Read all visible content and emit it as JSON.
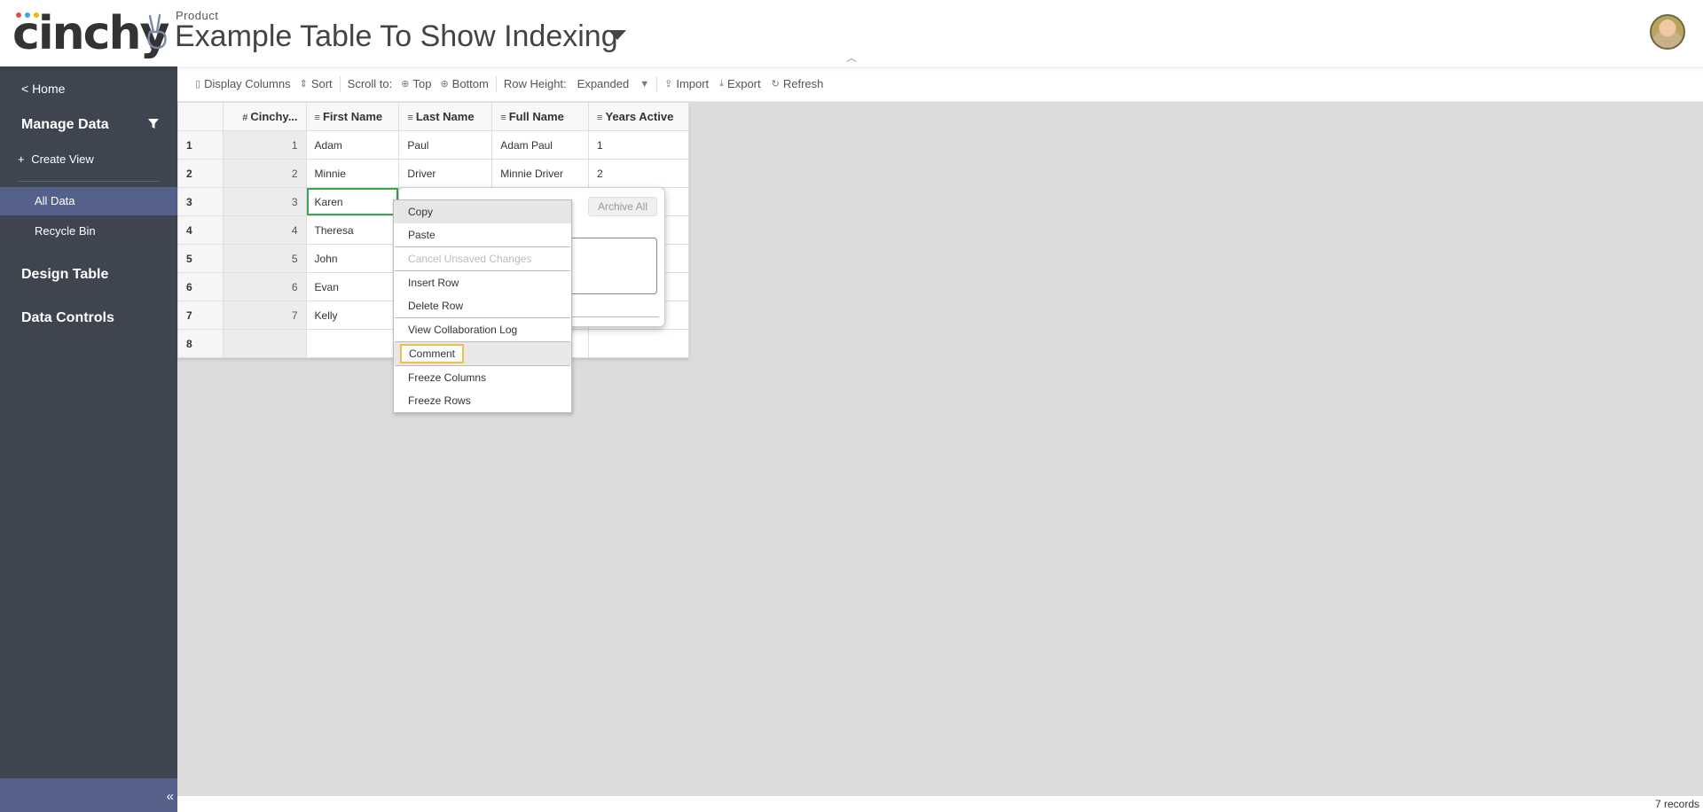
{
  "header": {
    "brand": "cinchy",
    "brand_dot_colors": [
      "#e94e3c",
      "#3fa9dd",
      "#f5b800"
    ],
    "product_label": "Product",
    "title": "Example Table To Show Indexing"
  },
  "sidebar": {
    "home": "< Home",
    "manage_data": "Manage Data",
    "create_view": "Create View",
    "create_view_prefix": "+",
    "views": [
      {
        "label": "All Data",
        "active": true
      },
      {
        "label": "Recycle Bin",
        "active": false
      }
    ],
    "design_table": "Design Table",
    "data_controls": "Data Controls",
    "collapse_glyph": "«"
  },
  "toolbar": {
    "display_columns": "Display Columns",
    "sort": "Sort",
    "scroll_to": "Scroll to:",
    "top": "Top",
    "bottom": "Bottom",
    "row_height_label": "Row Height:",
    "row_height_value": "Expanded",
    "import": "Import",
    "export": "Export",
    "refresh": "Refresh"
  },
  "grid": {
    "columns": [
      {
        "icon": "#",
        "label": "Cinchy..."
      },
      {
        "icon": "≡",
        "label": "First Name"
      },
      {
        "icon": "≡",
        "label": "Last Name"
      },
      {
        "icon": "≡",
        "label": "Full Name"
      },
      {
        "icon": "≡",
        "label": "Years Active"
      }
    ],
    "rows": [
      {
        "num": "1",
        "id": "1",
        "first": "Adam",
        "last": "Paul",
        "full": "Adam Paul",
        "years": "1"
      },
      {
        "num": "2",
        "id": "2",
        "first": "Minnie",
        "last": "Driver",
        "full": "Minnie Driver",
        "years": "2"
      },
      {
        "num": "3",
        "id": "3",
        "first": "Karen",
        "last": "",
        "full": "",
        "years": ""
      },
      {
        "num": "4",
        "id": "4",
        "first": "Theresa",
        "last": "",
        "full": "",
        "years": ""
      },
      {
        "num": "5",
        "id": "5",
        "first": "John",
        "last": "",
        "full": "",
        "years": ""
      },
      {
        "num": "6",
        "id": "6",
        "first": "Evan",
        "last": "",
        "full": "",
        "years": ""
      },
      {
        "num": "7",
        "id": "7",
        "first": "Kelly",
        "last": "",
        "full": "",
        "years": ""
      },
      {
        "num": "8",
        "id": "",
        "first": "",
        "last": "",
        "full": "",
        "years": ""
      }
    ]
  },
  "popup": {
    "archive_all": "Archive All"
  },
  "context_menu": {
    "copy": "Copy",
    "paste": "Paste",
    "cancel_unsaved": "Cancel Unsaved Changes",
    "insert_row": "Insert Row",
    "delete_row": "Delete Row",
    "view_log": "View Collaboration Log",
    "comment": "Comment",
    "freeze_columns": "Freeze Columns",
    "freeze_rows": "Freeze Rows"
  },
  "status": {
    "records": "7 records"
  }
}
